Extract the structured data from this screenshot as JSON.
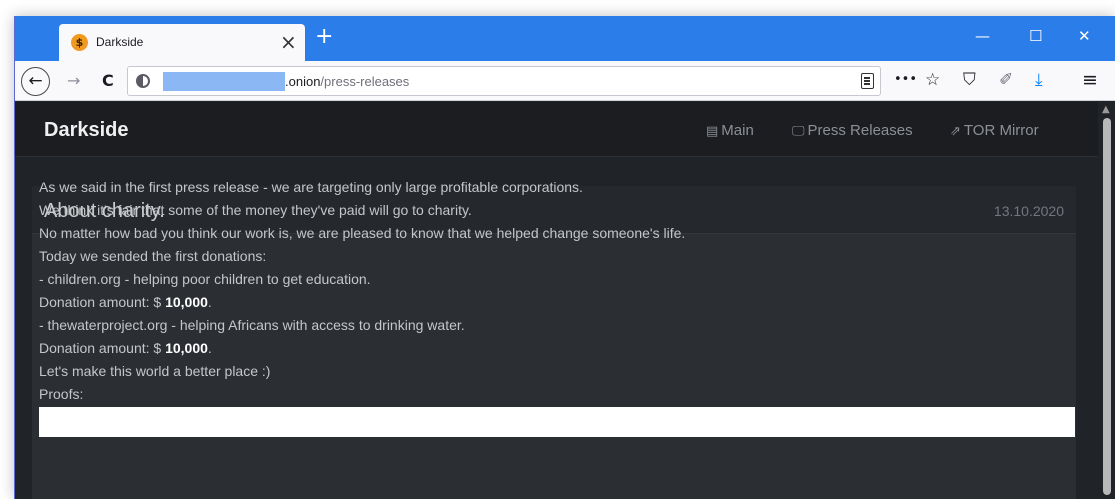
{
  "tab": {
    "title": "Darkside",
    "favicon_glyph": "$",
    "close": "×",
    "new_tab": "+"
  },
  "window_controls": {
    "minimize": "—",
    "maximize": "☐",
    "close": "✕"
  },
  "navbar": {
    "back": "←",
    "forward": "→",
    "reload": "C",
    "url_host": ".onion",
    "url_path": "/press-releases",
    "page_actions": "•••",
    "bookmark": "☆",
    "shield": "⛉",
    "extensions": "✐",
    "downloads": "⤓",
    "menu": "≡"
  },
  "site": {
    "brand": "Darkside",
    "nav": [
      {
        "icon": "▤",
        "label": "Main"
      },
      {
        "icon": "🖵",
        "label": "Press Releases"
      },
      {
        "icon": "⇗",
        "label": "TOR Mirror"
      }
    ]
  },
  "post": {
    "title": "About charity.",
    "date": "13.10.2020",
    "lines": [
      "As we said in the first press release - we are targeting only large profitable corporations.",
      "We think it's fair that some of the money they've paid will go to charity.",
      "No matter how bad you think our work is, we are pleased to know that we helped change someone's life.",
      "Today we sended the first donations:",
      "- children.org - helping poor children to get education."
    ],
    "donation1_prefix": "Donation amount: $ ",
    "donation1_amount": "10,000",
    "donation1_suffix": ".",
    "line_water": "- thewaterproject.org - helping Africans with access to drinking water.",
    "donation2_prefix": "Donation amount: $ ",
    "donation2_amount": "10,000",
    "donation2_suffix": ".",
    "line_world": "Let's make this world a better place :)",
    "line_proofs": "Proofs:"
  },
  "colors": {
    "titlebar": "#2b7de9",
    "page_bg": "#202327",
    "header_bg": "#1b1d21",
    "card_bg": "#2b2e33"
  }
}
